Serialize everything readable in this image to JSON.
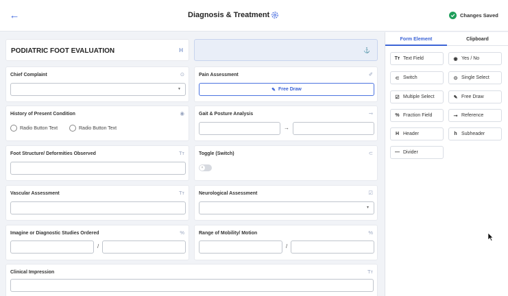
{
  "header": {
    "back_icon": "arrow-left-icon",
    "title": "Diagnosis & Treatment",
    "settings_icon": "gear-icon",
    "status": "Changes Saved",
    "status_color": "#1e9e5a"
  },
  "form": {
    "title": "PODIATRIC FOOT EVALUATION",
    "title_icon": "H",
    "fields": {
      "chief_complaint": "Chief Complaint",
      "pain_assessment": "Pain Assessment",
      "free_draw": "Free Draw",
      "history": "History of Present Condition",
      "radio_option_1": "Radio Button Text",
      "radio_option_2": "Radio Button Text",
      "gait": "Gait & Posture Analysis",
      "foot_structure": "Foot Structure/ Deformities Observed",
      "toggle": "Toggle (Switch)",
      "vascular": "Vascular Assessment",
      "neurological": "Neurological Assessment",
      "imaging": "Imagine or Diagnostic Studies Ordered",
      "range": "Range of Mobility/ Motion",
      "clinical": "Clinical Impression",
      "fraction_sep": "/",
      "arrow_sep": "→"
    }
  },
  "panel": {
    "tabs": [
      "Form Element",
      "Clipboard"
    ],
    "elements": [
      {
        "label": "Text Field",
        "icon": "Tт"
      },
      {
        "label": "Yes / No",
        "icon": "◉"
      },
      {
        "label": "Switch",
        "icon": "⊂"
      },
      {
        "label": "Single Select",
        "icon": "⊙"
      },
      {
        "label": "Multiple Select",
        "icon": "☑"
      },
      {
        "label": "Free Draw",
        "icon": "✎"
      },
      {
        "label": "Fraction Field",
        "icon": "%"
      },
      {
        "label": "Reference",
        "icon": "⊸"
      },
      {
        "label": "Header",
        "icon": "H"
      },
      {
        "label": "Subheader",
        "icon": "h"
      },
      {
        "label": "Divider",
        "icon": "—"
      }
    ]
  }
}
